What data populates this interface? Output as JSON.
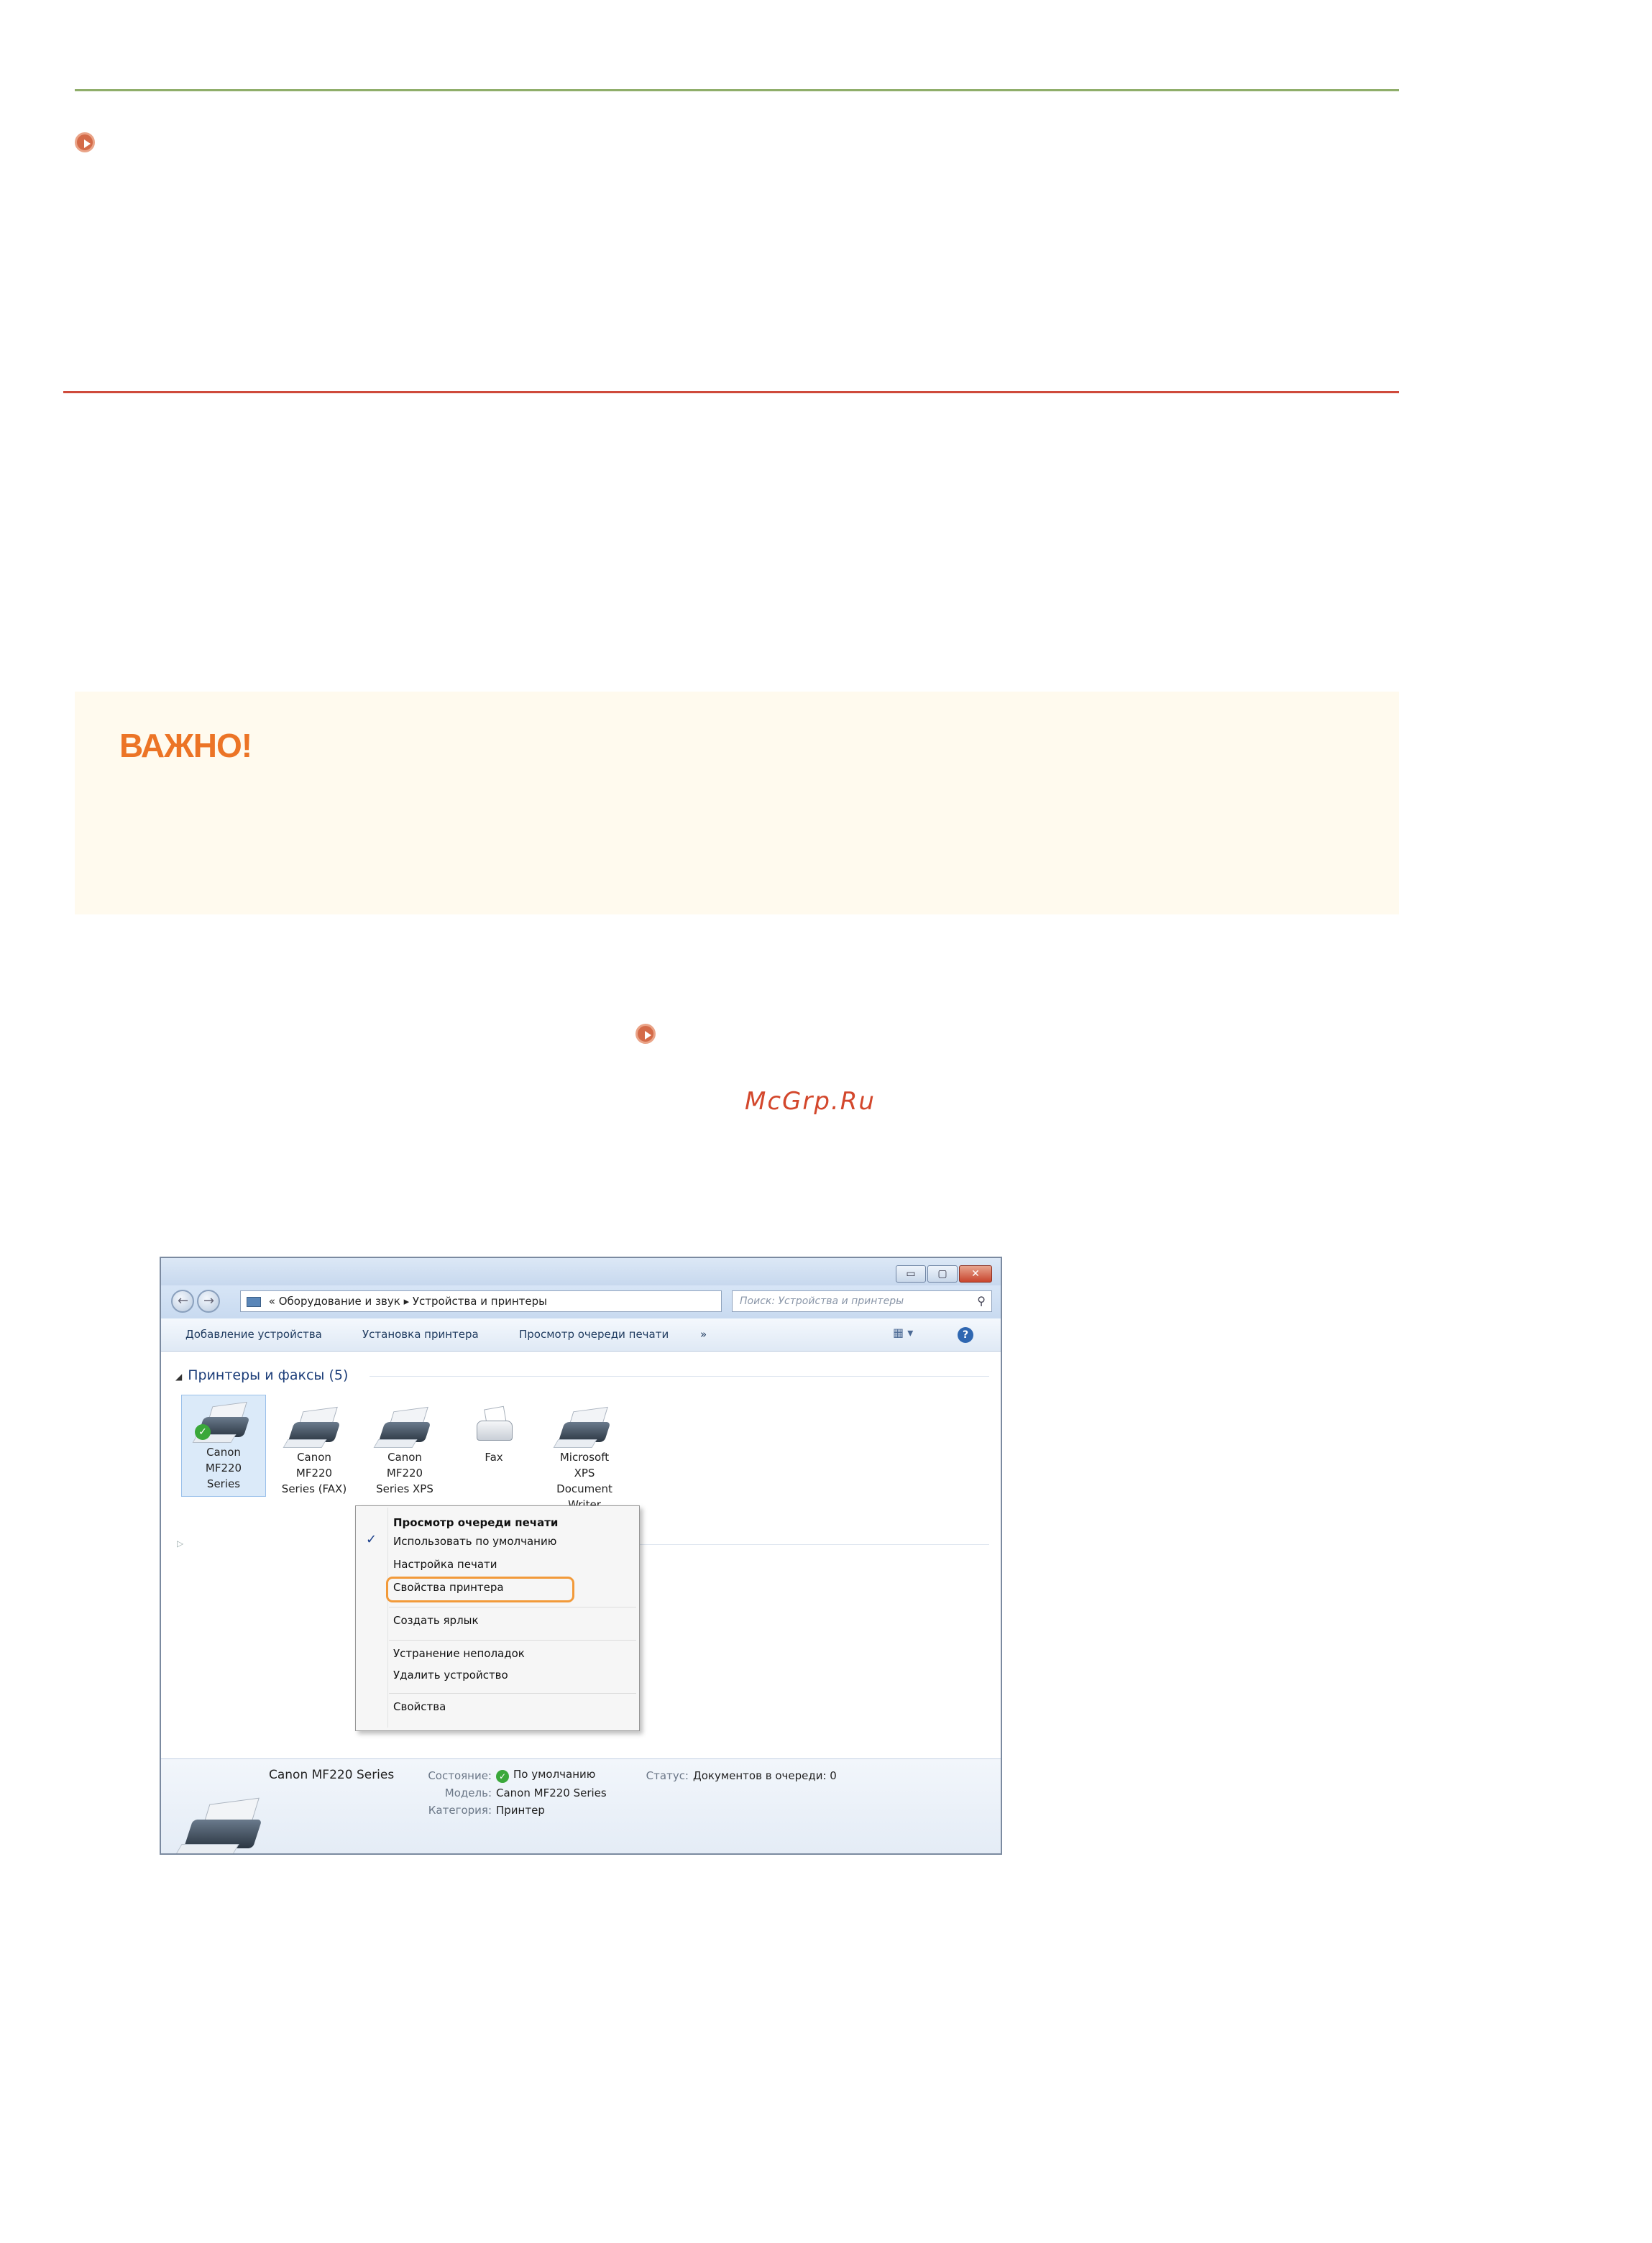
{
  "page": {
    "important_label": "ВАЖНО!",
    "watermark": "McGrp.Ru"
  },
  "window": {
    "caption_buttons": [
      "▭",
      "▢",
      "✕"
    ],
    "address": {
      "prefix": "«",
      "segments": [
        "Оборудование и звук",
        "▸",
        "Устройства и принтеры"
      ],
      "dropdown": "▾",
      "refresh": "↻"
    },
    "search": {
      "placeholder": "Поиск: Устройства и принтеры",
      "icon": "search-icon"
    },
    "toolbar": {
      "items": [
        "Добавление устройства",
        "Установка принтера",
        "Просмотр очереди печати",
        "»"
      ],
      "view_icon": "▦ ▾",
      "help_icon": "?"
    },
    "group": {
      "title": "Принтеры и факсы (5)"
    },
    "devices": [
      {
        "label": [
          "Canon",
          "MF220",
          "Series"
        ],
        "default": true,
        "selected": true,
        "icon": "printer-icon"
      },
      {
        "label": [
          "Canon",
          "MF220",
          "Series (FAX)"
        ],
        "icon": "printer-icon"
      },
      {
        "label": [
          "Canon",
          "MF220",
          "Series XPS"
        ],
        "icon": "printer-icon"
      },
      {
        "label": [
          "Fax"
        ],
        "icon": "fax-icon"
      },
      {
        "label": [
          "Microsoft",
          "XPS",
          "Document",
          "Writer"
        ],
        "icon": "printer-icon"
      }
    ],
    "context_menu": {
      "items": [
        {
          "label": "Просмотр очереди печати",
          "bold": true
        },
        {
          "label": "Использовать по умолчанию",
          "checked": true,
          "check": "✓"
        },
        {
          "label": "Настройка печати"
        },
        {
          "label": "Свойства принтера",
          "highlighted": true
        },
        {
          "label": "Создать ярлык"
        },
        {
          "label": "Устранение неполадок"
        },
        {
          "label": "Удалить устройство"
        },
        {
          "label": "Свойства"
        }
      ]
    },
    "details": {
      "name": "Canon MF220 Series",
      "state_key": "Состояние:",
      "state_value": "По умолчанию",
      "state_icon": "✓",
      "model_key": "Модель:",
      "model_value": "Canon MF220 Series",
      "category_key": "Категория:",
      "category_value": "Принтер",
      "status_key": "Статус:",
      "status_value": "Документов в очереди: 0"
    }
  }
}
